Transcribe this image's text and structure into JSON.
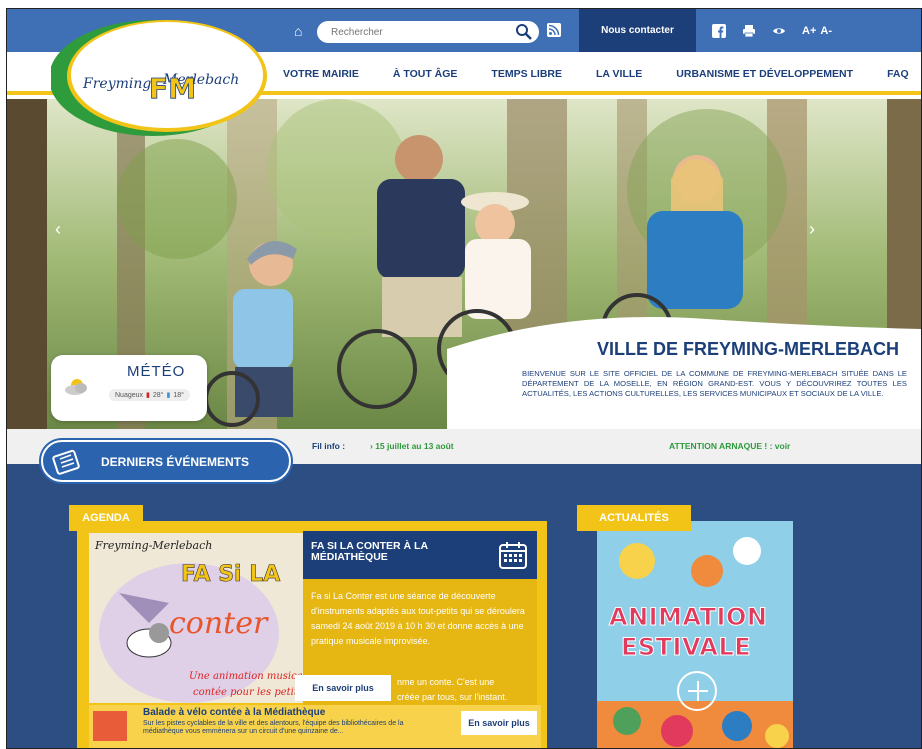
{
  "header": {
    "search_placeholder": "Rechercher",
    "contact_label": "Nous contacter",
    "font_increase": "A+",
    "font_decrease": "A-"
  },
  "logo": {
    "text": "Freyming-Merlebach",
    "monogram": "FM"
  },
  "nav": {
    "items": [
      "VOTRE MAIRIE",
      "À TOUT ÂGE",
      "TEMPS LIBRE",
      "LA VILLE",
      "URBANISME ET DÉVELOPPEMENT",
      "FAQ"
    ]
  },
  "hero": {
    "title": "VILLE DE FREYMING-MERLEBACH",
    "description": "Bienvenue sur le site officiel de la commune de Freyming-Merlebach située dans le département de la Moselle, en région Grand-Est. Vous y découvrirez toutes les actualités, les actions culturelles, les services municipaux et sociaux de la ville.",
    "prev_arrow": "‹",
    "next_arrow": "›"
  },
  "meteo": {
    "title": "MÉTÉO",
    "condition": "Nuageux",
    "temp_max": "28°",
    "temp_min": "18°"
  },
  "events_bar": {
    "label": "DERNIERS ÉVÉNEMENTS",
    "fil_label": "Fil info :",
    "fil_item1": "› 15 juillet au 13 août",
    "fil_item2": "ATTENTION ARNAQUE ! : voir"
  },
  "agenda": {
    "tag": "AGENDA",
    "image_title": "Freyming-Merlebach",
    "image_line1": "FA Si LA",
    "image_line2": "conter",
    "image_caption1": "Une animation musicale",
    "image_caption2": "contée pour les petits",
    "event_title": "FA SI LA CONTER À LA MÉDIATHÈQUE",
    "event_desc": "Fa si La Conter est une séance de découverte d'instruments adaptés aux tout-petits qui se déroulera samedi 24 août 2019 à 10 h 30 et donne accès à une pratique musicale improvisée.",
    "event_desc_partial1": "nme un conte. C'est une",
    "event_desc_partial2": "créée par tous, sur l'instant.",
    "more_label": "En savoir plus",
    "event2_title": "Balade à vélo contée à la Médiathèque",
    "event2_desc": "Sur les pistes cyclables de la ville et des alentours, l'équipe des bibliothécaires de la médiathèque vous emmènera sur un circuit d'une quinzaine de...",
    "event2_more": "En savoir plus"
  },
  "actualites": {
    "tag": "ACTUALITÉS",
    "poster_line1": "ANIMATION",
    "poster_line2": "ESTIVALE"
  },
  "colors": {
    "primary_blue": "#3f6fb5",
    "dark_blue": "#1c3f7a",
    "yellow": "#f2c417",
    "green": "#2e9b3d"
  }
}
